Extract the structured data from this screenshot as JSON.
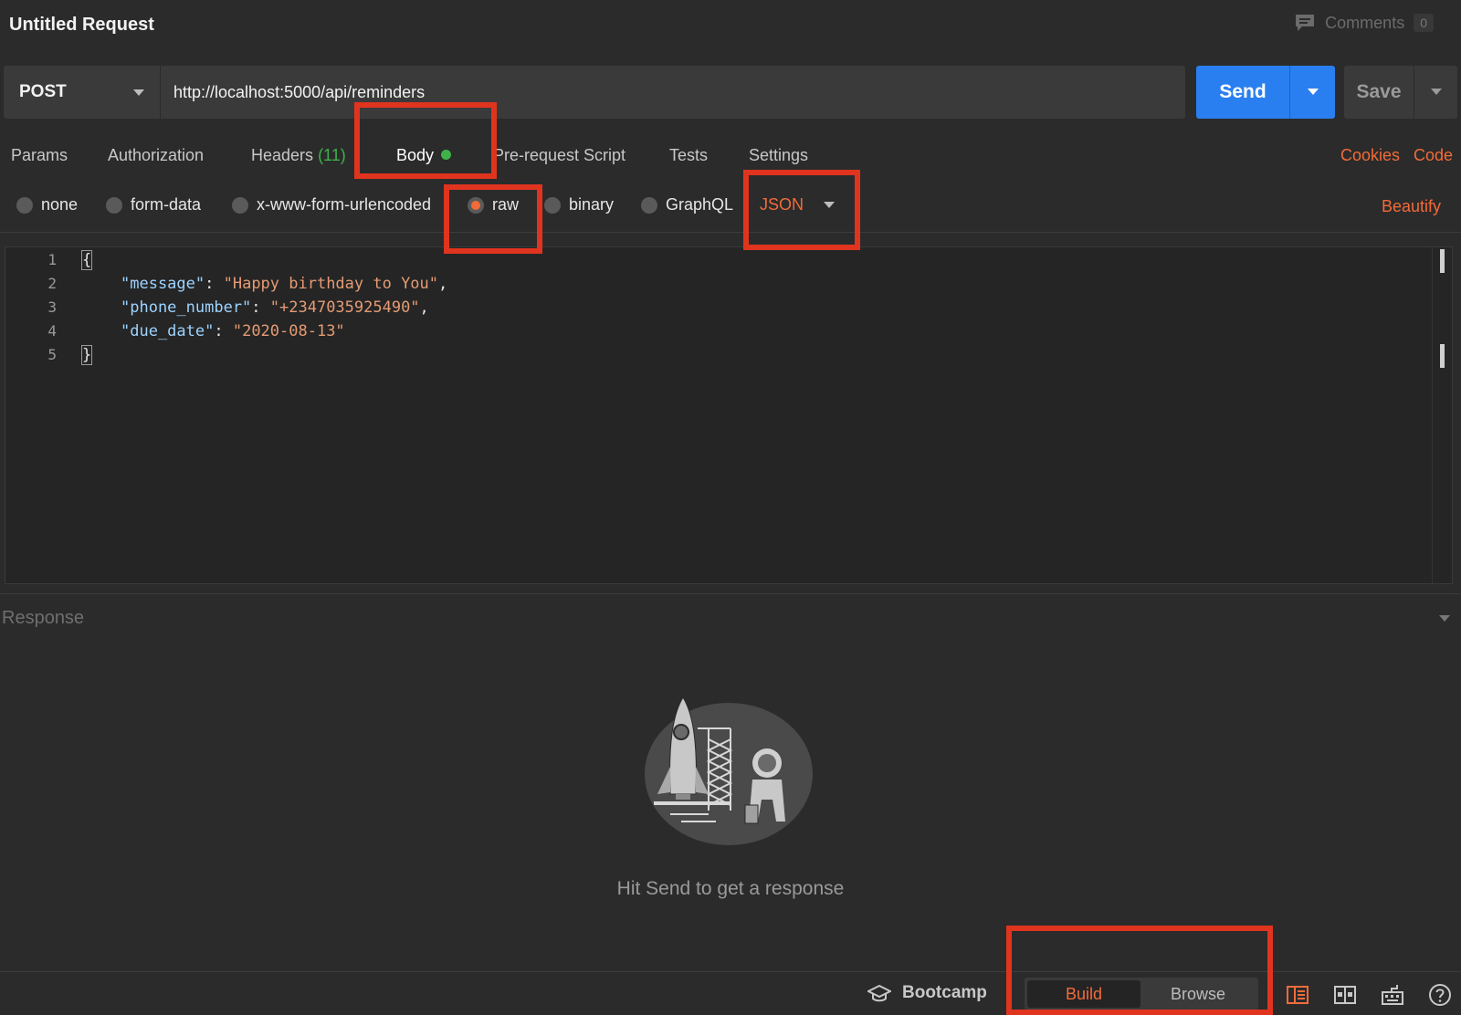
{
  "title": "Untitled Request",
  "comments": {
    "label": "Comments",
    "count": "0"
  },
  "request": {
    "method": "POST",
    "url": "http://localhost:5000/api/reminders",
    "send_label": "Send",
    "save_label": "Save"
  },
  "tabs": [
    {
      "label": "Params"
    },
    {
      "label": "Authorization"
    },
    {
      "label": "Headers",
      "count": "(11)"
    },
    {
      "label": "Body"
    },
    {
      "label": "Pre-request Script"
    },
    {
      "label": "Tests"
    },
    {
      "label": "Settings"
    }
  ],
  "links": {
    "cookies": "Cookies",
    "code": "Code"
  },
  "body_types": [
    {
      "label": "none",
      "selected": false
    },
    {
      "label": "form-data",
      "selected": false
    },
    {
      "label": "x-www-form-urlencoded",
      "selected": false
    },
    {
      "label": "raw",
      "selected": true
    },
    {
      "label": "binary",
      "selected": false
    },
    {
      "label": "GraphQL",
      "selected": false
    }
  ],
  "format_select": "JSON",
  "beautify_label": "Beautify",
  "editor": {
    "line_numbers": [
      "1",
      "2",
      "3",
      "4",
      "5"
    ],
    "lines": {
      "open": "{",
      "l2_key": "\"message\"",
      "l2_val": "\"Happy birthday to You\"",
      "l3_key": "\"phone_number\"",
      "l3_val": "\"+2347035925490\"",
      "l4_key": "\"due_date\"",
      "l4_val": "\"2020-08-13\"",
      "close": "}"
    }
  },
  "response": {
    "label": "Response",
    "hint": "Hit Send to get a response"
  },
  "footer": {
    "bootcamp": "Bootcamp",
    "build": "Build",
    "browse": "Browse"
  },
  "colors": {
    "accent": "#f26b3a",
    "send": "#2a7ff0",
    "success": "#3fb24a",
    "annotation": "#e0341f"
  }
}
